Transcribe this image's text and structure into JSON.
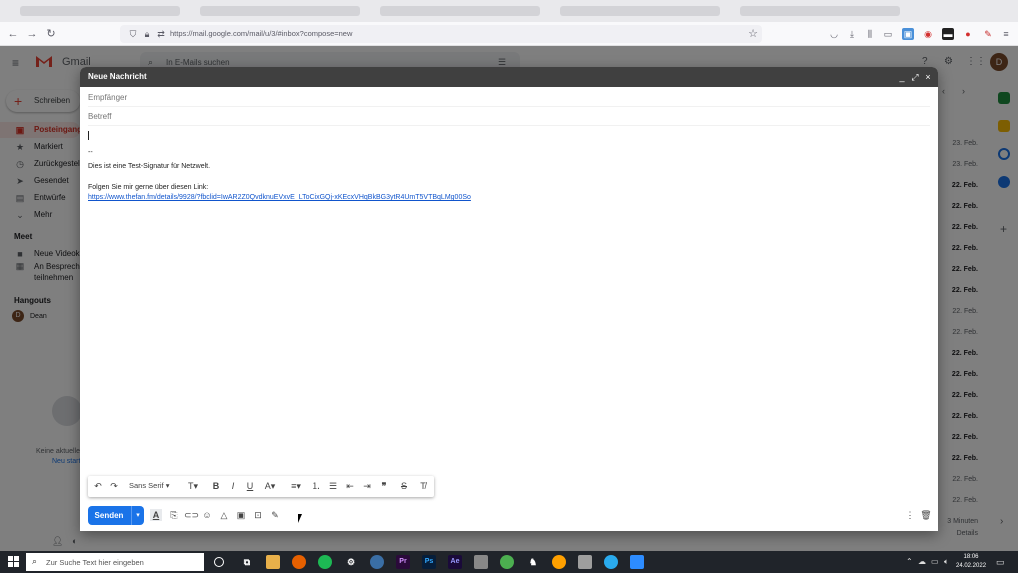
{
  "browser": {
    "url": "https://mail.google.com/mail/u/3/#inbox?compose=new",
    "icons": [
      "back-icon",
      "forward-icon",
      "reload-icon",
      "shield-icon",
      "lock-icon",
      "bookmark-star-icon",
      "pocket-icon",
      "download-icon",
      "library-icon",
      "reader-icon",
      "extensions-icon",
      "menu-icon"
    ]
  },
  "gmail": {
    "logo_text": "Gmail",
    "search_placeholder": "In E-Mails suchen",
    "compose_button": "Schreiben",
    "sidebar": [
      {
        "label": "Posteingang",
        "icon": "inbox-icon",
        "active": true
      },
      {
        "label": "Markiert",
        "icon": "star-icon"
      },
      {
        "label": "Zurückgestellt",
        "icon": "clock-icon"
      },
      {
        "label": "Gesendet",
        "icon": "send-icon"
      },
      {
        "label": "Entwürfe",
        "icon": "draft-icon"
      },
      {
        "label": "Mehr",
        "icon": "chevron-down-icon"
      }
    ],
    "meet": {
      "title": "Meet",
      "new_meeting": "Neue Videokonferenz",
      "join_1": "An Besprechung",
      "join_2": "teilnehmen"
    },
    "hangouts": {
      "title": "Hangouts",
      "user": "Dean",
      "empty_1": "Keine aktuellen Chats",
      "empty_2": "Neu starten"
    },
    "dates": [
      "23. Feb.",
      "23. Feb.",
      "22. Feb.",
      "22. Feb.",
      "22. Feb.",
      "22. Feb.",
      "22. Feb.",
      "22. Feb.",
      "22. Feb.",
      "22. Feb.",
      "22. Feb.",
      "22. Feb.",
      "22. Feb.",
      "22. Feb.",
      "22. Feb.",
      "22. Feb.",
      "22. Feb.",
      "22. Feb."
    ],
    "dates_bold": [
      false,
      false,
      true,
      true,
      true,
      true,
      true,
      true,
      false,
      false,
      true,
      true,
      true,
      true,
      true,
      true,
      false,
      false
    ],
    "activity_1": "3 Minuten",
    "activity_2": "Details",
    "avatar_letter": "D"
  },
  "compose": {
    "title": "Neue Nachricht",
    "to_placeholder": "Empfänger",
    "subject_placeholder": "Betreff",
    "signature_sep": "--",
    "signature_line": "Dies ist eine Test-Signatur für Netzwelt.",
    "follow_line": "Folgen Sie mir gerne über diesen Link:",
    "link": "https://www.thefan.fm/details/9928/?fbclid=IwAR2Z0QvdknuEVxvE_LToCixGQj-xKEcxVHqBkBG3ytR4UmT5VTBqLMg00So",
    "font": "Sans Serif",
    "send_label": "Senden"
  },
  "taskbar": {
    "search_placeholder": "Zur Suche Text hier eingeben",
    "time": "18:06",
    "date": "24.02.2022"
  }
}
